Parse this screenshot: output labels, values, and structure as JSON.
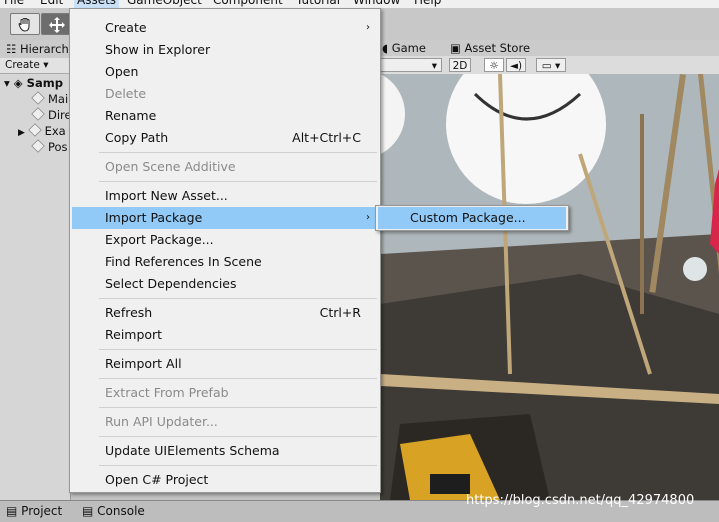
{
  "menubar": {
    "items": [
      "File",
      "Edit",
      "Assets",
      "GameObject",
      "Component",
      "Tutorial",
      "Window",
      "Help"
    ]
  },
  "hierarchy": {
    "tab_label": "Hierarch",
    "create_label": "Create",
    "scene_name": "Samp",
    "rows": [
      "Mai",
      "Dire",
      "Exa",
      "Pos"
    ]
  },
  "scene_panel": {
    "tabs": [
      "Game",
      "Asset Store"
    ],
    "toolbar": {
      "mode_2d": "2D"
    }
  },
  "assets_menu": {
    "items": [
      {
        "label": "Create",
        "shortcut": "",
        "submenu": true,
        "disabled": false
      },
      {
        "label": "Show in Explorer",
        "shortcut": "",
        "submenu": false,
        "disabled": false
      },
      {
        "label": "Open",
        "shortcut": "",
        "submenu": false,
        "disabled": false
      },
      {
        "label": "Delete",
        "shortcut": "",
        "submenu": false,
        "disabled": true
      },
      {
        "label": "Rename",
        "shortcut": "",
        "submenu": false,
        "disabled": false
      },
      {
        "label": "Copy Path",
        "shortcut": "Alt+Ctrl+C",
        "submenu": false,
        "disabled": false
      },
      {
        "label": "Open Scene Additive",
        "shortcut": "",
        "submenu": false,
        "disabled": true
      },
      {
        "label": "Import New Asset...",
        "shortcut": "",
        "submenu": false,
        "disabled": false
      },
      {
        "label": "Import Package",
        "shortcut": "",
        "submenu": true,
        "disabled": false,
        "highlighted": true
      },
      {
        "label": "Export Package...",
        "shortcut": "",
        "submenu": false,
        "disabled": false
      },
      {
        "label": "Find References In Scene",
        "shortcut": "",
        "submenu": false,
        "disabled": false
      },
      {
        "label": "Select Dependencies",
        "shortcut": "",
        "submenu": false,
        "disabled": false
      },
      {
        "label": "Refresh",
        "shortcut": "Ctrl+R",
        "submenu": false,
        "disabled": false
      },
      {
        "label": "Reimport",
        "shortcut": "",
        "submenu": false,
        "disabled": false
      },
      {
        "label": "Reimport All",
        "shortcut": "",
        "submenu": false,
        "disabled": false
      },
      {
        "label": "Extract From Prefab",
        "shortcut": "",
        "submenu": false,
        "disabled": true
      },
      {
        "label": "Run API Updater...",
        "shortcut": "",
        "submenu": false,
        "disabled": true
      },
      {
        "label": "Update UIElements Schema",
        "shortcut": "",
        "submenu": false,
        "disabled": false
      },
      {
        "label": "Open C# Project",
        "shortcut": "",
        "submenu": false,
        "disabled": false
      }
    ]
  },
  "import_package_submenu": {
    "items": [
      {
        "label": "Custom Package...",
        "highlighted": true
      }
    ]
  },
  "bottom_tabs": [
    "Project",
    "Console"
  ],
  "watermark": "https://blog.csdn.net/qq_42974800",
  "colors": {
    "highlight": "#91c9f7",
    "menu_bg": "#f0f0f0",
    "disabled_text": "#8a8a8a"
  }
}
